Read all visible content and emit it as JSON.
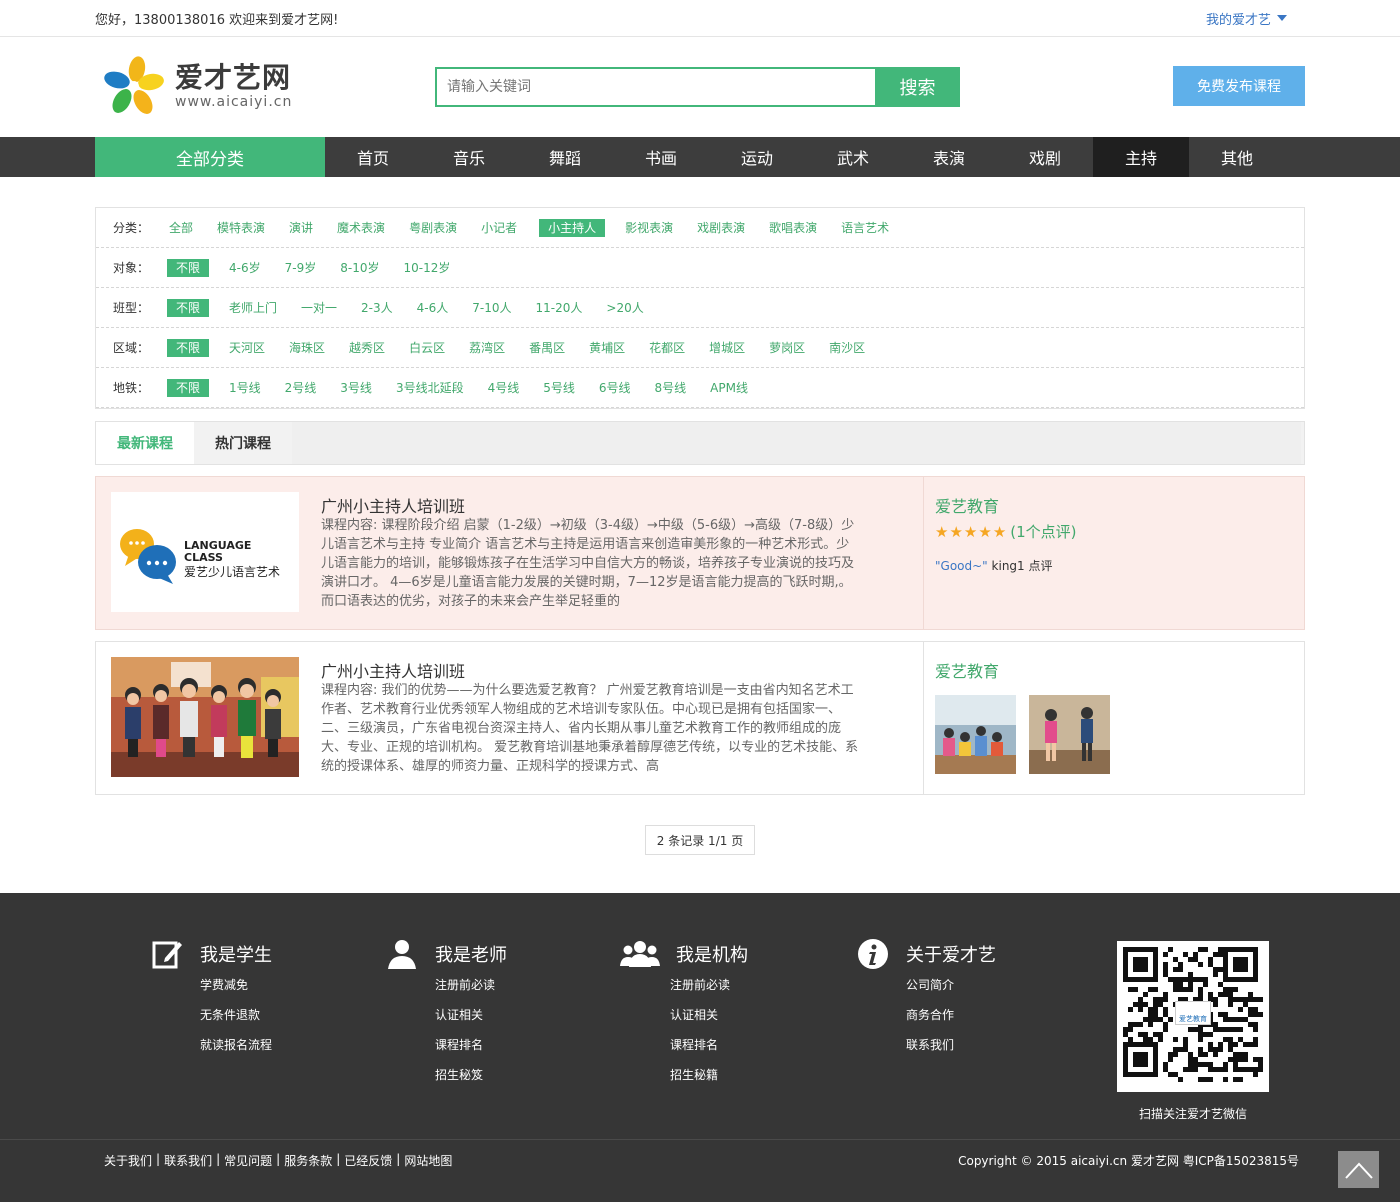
{
  "topbar": {
    "welcome": "您好，13800138016 欢迎来到爱才艺网!",
    "my_account": "我的爱才艺"
  },
  "header": {
    "logo_cn": "爱才艺网",
    "logo_en": "www.aicaiyi.cn",
    "search_placeholder": "请输入关键词",
    "search_button": "搜索",
    "publish_button": "免费发布课程"
  },
  "nav": {
    "all_categories": "全部分类",
    "items": [
      "首页",
      "音乐",
      "舞蹈",
      "书画",
      "运动",
      "武术",
      "表演",
      "戏剧",
      "主持",
      "其他"
    ],
    "active_index": 8
  },
  "filters": [
    {
      "label": "分类：",
      "options": [
        "全部",
        "模特表演",
        "演讲",
        "魔术表演",
        "粤剧表演",
        "小记者",
        "小主持人",
        "影视表演",
        "戏剧表演",
        "歌唱表演",
        "语言艺术"
      ],
      "selected": "小主持人"
    },
    {
      "label": "对象：",
      "options": [
        "不限",
        "4-6岁",
        "7-9岁",
        "8-10岁",
        "10-12岁"
      ],
      "selected": "不限"
    },
    {
      "label": "班型：",
      "options": [
        "不限",
        "老师上门",
        "一对一",
        "2-3人",
        "4-6人",
        "7-10人",
        "11-20人",
        ">20人"
      ],
      "selected": "不限"
    },
    {
      "label": "区域：",
      "options": [
        "不限",
        "天河区",
        "海珠区",
        "越秀区",
        "白云区",
        "荔湾区",
        "番禺区",
        "黄埔区",
        "花都区",
        "增城区",
        "萝岗区",
        "南沙区"
      ],
      "selected": "不限"
    },
    {
      "label": "地铁：",
      "options": [
        "不限",
        "1号线",
        "2号线",
        "3号线",
        "3号线北延段",
        "4号线",
        "5号线",
        "6号线",
        "8号线",
        "APM线"
      ],
      "selected": "不限"
    }
  ],
  "tabs": [
    {
      "label": "最新课程",
      "active": true
    },
    {
      "label": "热门课程",
      "active": false
    }
  ],
  "courses": [
    {
      "title": "广州小主持人培训班",
      "thumb_text_1": "LANGUAGE",
      "thumb_text_2": "CLASS",
      "thumb_text_3": "爱艺少儿语言艺术",
      "description": "课程内容: 课程阶段介绍  启蒙（1-2级）→初级（3-4级）→中级（5-6级）→高级（7-8级）少儿语言艺术与主持  专业简介      语言艺术与主持是运用语言来创造审美形象的一种艺术形式。少儿语言能力的培训，能够锻炼孩子在生活学习中自信大方的畅谈，培养孩子专业演说的技巧及演讲口才。    4—6岁是儿童语言能力发展的关键时期，7—12岁是语言能力提高的飞跃时期,。而口语表达的优劣，对孩子的未来会产生举足轻重的",
      "org": "爱艺教育",
      "rating_stars": 5,
      "rating_count": "(1个点评)",
      "review_quote": "\"Good~\"",
      "review_user": "king1 点评"
    },
    {
      "title": "广州小主持人培训班",
      "description": "课程内容: 我们的优势——为什么要选爱艺教育？    广州爱艺教育培训是一支由省内知名艺术工作者、艺术教育行业优秀领军人物组成的艺术培训专家队伍。中心现已是拥有包括国家一、二、三级演员，广东省电视台资深主持人、省内长期从事儿童艺术教育工作的教师组成的庞大、专业、正规的培训机构。    爱艺教育培训基地秉承着醇厚德艺传统，以专业的艺术技能、系统的授课体系、雄厚的师资力量、正规科学的授课方式、高",
      "org": "爱艺教育"
    }
  ],
  "pager": {
    "text": "2 条记录 1/1 页"
  },
  "footer": {
    "columns": [
      {
        "title": "我是学生",
        "icon": "edit-icon",
        "links": [
          "学费减免",
          "无条件退款",
          "就读报名流程"
        ]
      },
      {
        "title": "我是老师",
        "icon": "user-icon",
        "links": [
          "注册前必读",
          "认证相关",
          "课程排名",
          "招生秘笈"
        ]
      },
      {
        "title": "我是机构",
        "icon": "group-icon",
        "links": [
          "注册前必读",
          "认证相关",
          "课程排名",
          "招生秘籍"
        ]
      },
      {
        "title": "关于爱才艺",
        "icon": "info-icon",
        "links": [
          "公司简介",
          "商务合作",
          "联系我们"
        ]
      }
    ],
    "qr_caption": "扫描关注爱才艺微信",
    "qr_label": "爱艺教育",
    "bottom_links": [
      "关于我们",
      "联系我们",
      "常见问题",
      "服务条款",
      "已经反馈",
      "网站地图"
    ],
    "copyright": "Copyright © 2015 aicaiyi.cn 爱才艺网 粤ICP备15023815号"
  },
  "colors": {
    "brand_green": "#42b77a",
    "nav_dark": "#3d3d3d",
    "publish_blue": "#5fb0ea",
    "footer_bg": "#363636",
    "card_pink": "#fcedea"
  }
}
